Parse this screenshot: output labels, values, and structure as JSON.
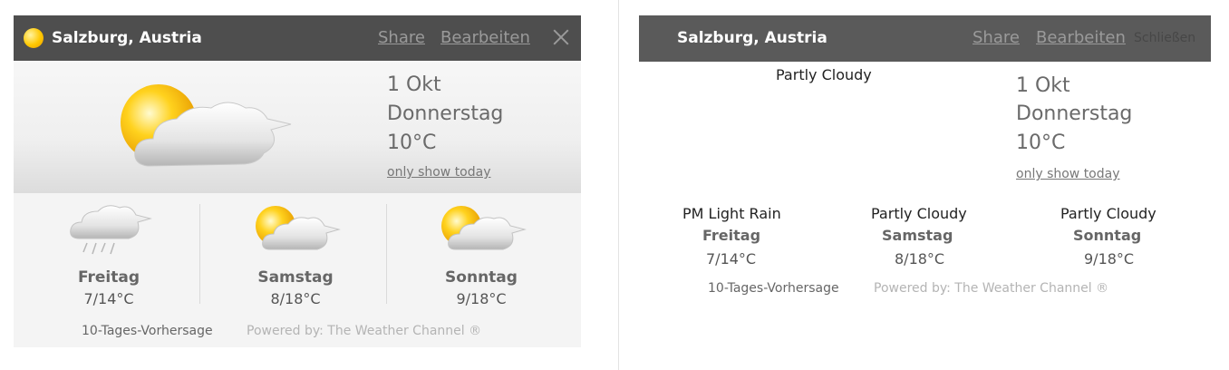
{
  "colors": {
    "header_bg": "#4e4e4e",
    "sun": "#ffc800",
    "link": "#9a9a9a"
  },
  "widget_left": {
    "header": {
      "city": "Salzburg, Austria",
      "share": "Share",
      "edit": "Bearbeiten",
      "close_icon": "close-icon"
    },
    "today": {
      "icon": "partly-cloudy-icon",
      "date": "1 Okt",
      "weekday": "Donnerstag",
      "temp": "10°C",
      "only_today": "only show today"
    },
    "forecast": [
      {
        "icon": "light-rain-icon",
        "day": "Freitag",
        "temp": "7/14°C"
      },
      {
        "icon": "partly-cloudy-icon",
        "day": "Samstag",
        "temp": "8/18°C"
      },
      {
        "icon": "partly-cloudy-icon",
        "day": "Sonntag",
        "temp": "9/18°C"
      }
    ],
    "footer": {
      "ten_day": "10-Tages-Vorhersage",
      "powered": "Powered by: The Weather Channel ®"
    }
  },
  "widget_right": {
    "header": {
      "city": "Salzburg, Austria",
      "share": "Share",
      "edit": "Bearbeiten",
      "close": "Schließen"
    },
    "today": {
      "condition": "Partly Cloudy",
      "date": "1 Okt",
      "weekday": "Donnerstag",
      "temp": "10°C",
      "only_today": "only show today"
    },
    "forecast": [
      {
        "condition": "PM Light Rain",
        "day": "Freitag",
        "temp": "7/14°C"
      },
      {
        "condition": "Partly Cloudy",
        "day": "Samstag",
        "temp": "8/18°C"
      },
      {
        "condition": "Partly Cloudy",
        "day": "Sonntag",
        "temp": "9/18°C"
      }
    ],
    "footer": {
      "ten_day": "10-Tages-Vorhersage",
      "powered": "Powered by: The Weather Channel ®"
    }
  }
}
